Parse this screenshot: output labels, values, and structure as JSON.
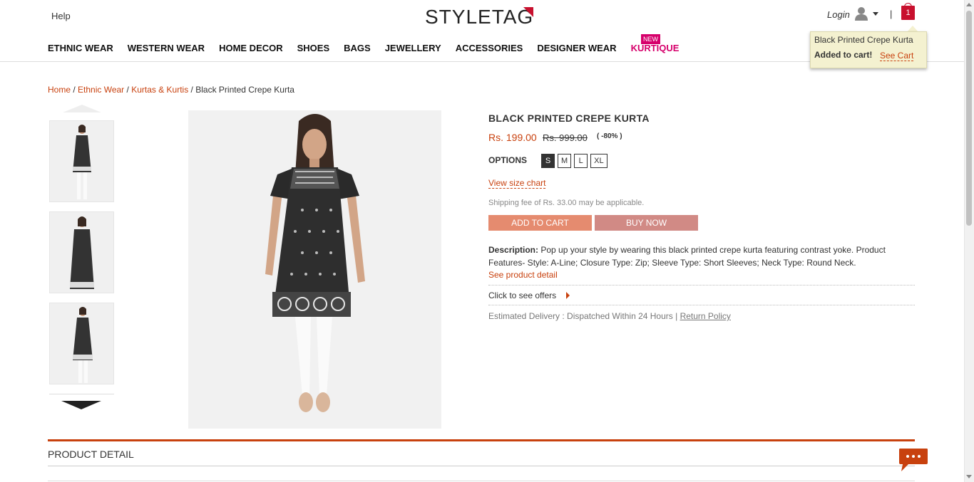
{
  "header": {
    "help_label": "Help",
    "logo_text": "STYLETAG",
    "login_label": "Login",
    "separator": "|",
    "cart_count": "1"
  },
  "nav": {
    "items": [
      "ETHNIC WEAR",
      "WESTERN WEAR",
      "HOME DECOR",
      "SHOES",
      "BAGS",
      "JEWELLERY",
      "ACCESSORIES",
      "DESIGNER WEAR",
      "KURTIQUE"
    ],
    "new_badge": "NEW"
  },
  "cart_popup": {
    "product_name": "Black Printed Crepe Kurta",
    "added_text": "Added to cart!",
    "see_cart_label": "See Cart"
  },
  "breadcrumb": {
    "home": "Home",
    "sep": " / ",
    "ethnic": "Ethnic Wear",
    "kurtas": "Kurtas & Kurtis",
    "current": "Black Printed Crepe Kurta"
  },
  "product": {
    "title": "BLACK PRINTED CREPE KURTA",
    "price": "Rs. 199.00",
    "mrp": "Rs. 999.00",
    "discount": "( -80% )",
    "options_label": "OPTIONS",
    "sizes": [
      "S",
      "M",
      "L",
      "XL"
    ],
    "selected_size": "S",
    "size_chart_label": "View size chart",
    "shipping_text": "Shipping fee of Rs. 33.00 may be applicable.",
    "add_to_cart_label": "ADD TO CART",
    "buy_now_label": "BUY NOW",
    "description_label": "Description:",
    "description": " Pop up your style by wearing this black printed crepe kurta featuring contrast yoke. Product Features- Style: A-Line; Closure Type: Zip; Sleeve Type: Short Sleeves; Neck Type: Round Neck.",
    "see_detail_label": "See product detail",
    "offers_label": "Click to see offers",
    "delivery_text": "Estimated Delivery : Dispatched Within 24 Hours | ",
    "return_policy_label": "Return Policy"
  },
  "product_detail": {
    "heading": "PRODUCT DETAIL"
  },
  "colors": {
    "accent": "#c8410e",
    "kurtique": "#d6006b",
    "cart_badge": "#c8102e"
  }
}
